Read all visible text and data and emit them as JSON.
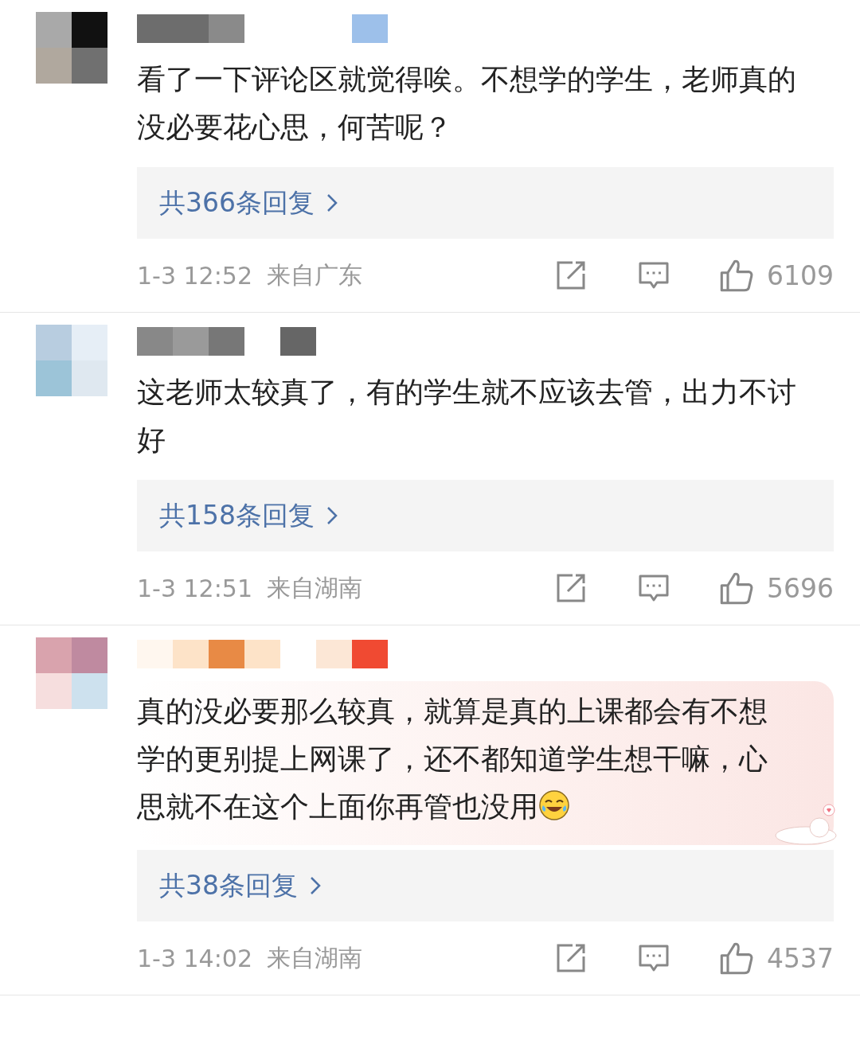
{
  "comments": [
    {
      "text": "看了一下评论区就觉得唉。不想学的学生，老师真的没必要花心思，何苦呢？",
      "decorated": false,
      "laughing_emoji": false,
      "replies": "共366条回复",
      "time": "1-3 12:52",
      "location": "来自广东",
      "likes": "6109"
    },
    {
      "text": "这老师太较真了，有的学生就不应该去管，出力不讨好",
      "decorated": false,
      "laughing_emoji": false,
      "replies": "共158条回复",
      "time": "1-3 12:51",
      "location": "来自湖南",
      "likes": "5696"
    },
    {
      "text": "真的没必要那么较真，就算是真的上课都会有不想学的更别提上网课了，还不都知道学生想干嘛，心思就不在这个上面你再管也没用",
      "decorated": true,
      "laughing_emoji": true,
      "replies": "共38条回复",
      "time": "1-3 14:02",
      "location": "来自湖南",
      "likes": "4537"
    }
  ]
}
